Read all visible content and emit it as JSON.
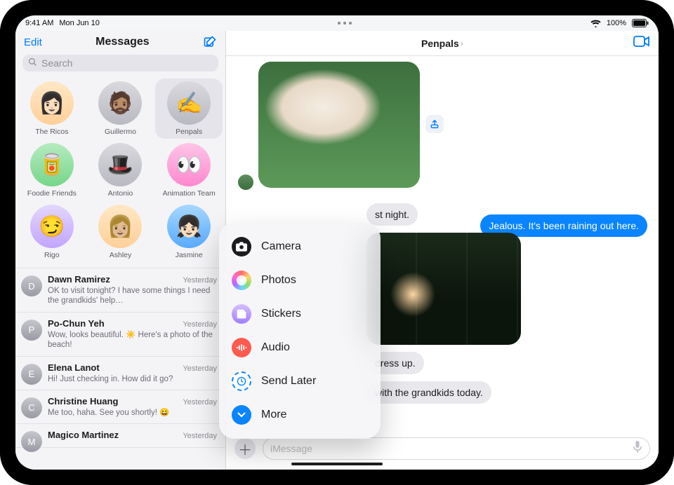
{
  "status": {
    "time": "9:41 AM",
    "date": "Mon Jun 10",
    "battery": "100%"
  },
  "sidebar": {
    "edit_label": "Edit",
    "title": "Messages",
    "search_placeholder": "Search",
    "pins": [
      {
        "label": "The Ricos",
        "avatar_class": "tan",
        "emoji": "👩🏻"
      },
      {
        "label": "Guillermo",
        "avatar_class": "gray",
        "emoji": "🧔🏽"
      },
      {
        "label": "Penpals",
        "avatar_class": "gray",
        "emoji": "✍️",
        "selected": true
      },
      {
        "label": "Foodie Friends",
        "avatar_class": "green",
        "emoji": "🥫"
      },
      {
        "label": "Antonio",
        "avatar_class": "gray",
        "emoji": "🎩"
      },
      {
        "label": "Animation Team",
        "avatar_class": "pink",
        "emoji": "👀"
      },
      {
        "label": "Rigo",
        "avatar_class": "purple",
        "emoji": "😏"
      },
      {
        "label": "Ashley",
        "avatar_class": "tan",
        "emoji": "👩🏼"
      },
      {
        "label": "Jasmine",
        "avatar_class": "blue",
        "emoji": "👧🏻"
      }
    ],
    "conversations": [
      {
        "name": "Dawn Ramirez",
        "time": "Yesterday",
        "preview": "OK to visit tonight? I have some things I need the grandkids' help…"
      },
      {
        "name": "Po-Chun Yeh",
        "time": "Yesterday",
        "preview": "Wow, looks beautiful. ☀️ Here's a photo of the beach!"
      },
      {
        "name": "Elena Lanot",
        "time": "Yesterday",
        "preview": "Hi! Just checking in. How did it go?"
      },
      {
        "name": "Christine Huang",
        "time": "Yesterday",
        "preview": "Me too, haha. See you shortly! 😄"
      },
      {
        "name": "Magico Martinez",
        "time": "Yesterday",
        "preview": ""
      }
    ]
  },
  "main": {
    "title": "Penpals",
    "outgoing_1": "Jealous. It's been raining out here.",
    "incoming_partial_1": "st night.",
    "incoming_partial_2": "dress up.",
    "incoming_partial_3": "with the grandkids today.",
    "input_placeholder": "iMessage"
  },
  "popover": {
    "items": [
      {
        "label": "Camera",
        "icon": "cam",
        "name": "camera-icon"
      },
      {
        "label": "Photos",
        "icon": "ph",
        "name": "photos-icon"
      },
      {
        "label": "Stickers",
        "icon": "st",
        "name": "stickers-icon"
      },
      {
        "label": "Audio",
        "icon": "au",
        "name": "audio-icon"
      },
      {
        "label": "Send Later",
        "icon": "sl",
        "name": "send-later-icon"
      },
      {
        "label": "More",
        "icon": "mo",
        "name": "more-icon"
      }
    ]
  }
}
